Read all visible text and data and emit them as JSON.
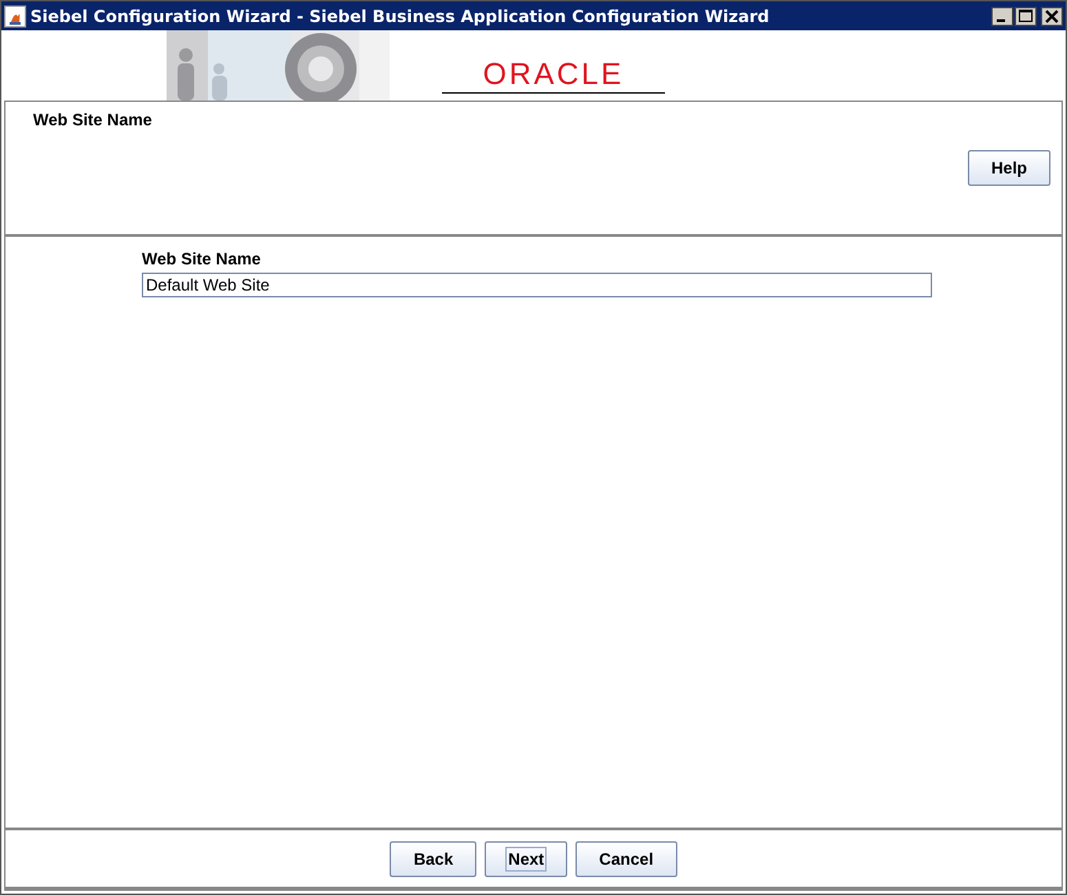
{
  "window": {
    "title": "Siebel Configuration Wizard - Siebel Business Application Configuration Wizard"
  },
  "banner": {
    "logo": "ORACLE"
  },
  "header": {
    "title": "Web Site Name",
    "help_button": "Help"
  },
  "form": {
    "label": "Web Site Name",
    "value": "Default Web Site"
  },
  "buttons": [
    {
      "label": "Back",
      "focused": false
    },
    {
      "label": "Next",
      "focused": true
    },
    {
      "label": "Cancel",
      "focused": false
    }
  ]
}
